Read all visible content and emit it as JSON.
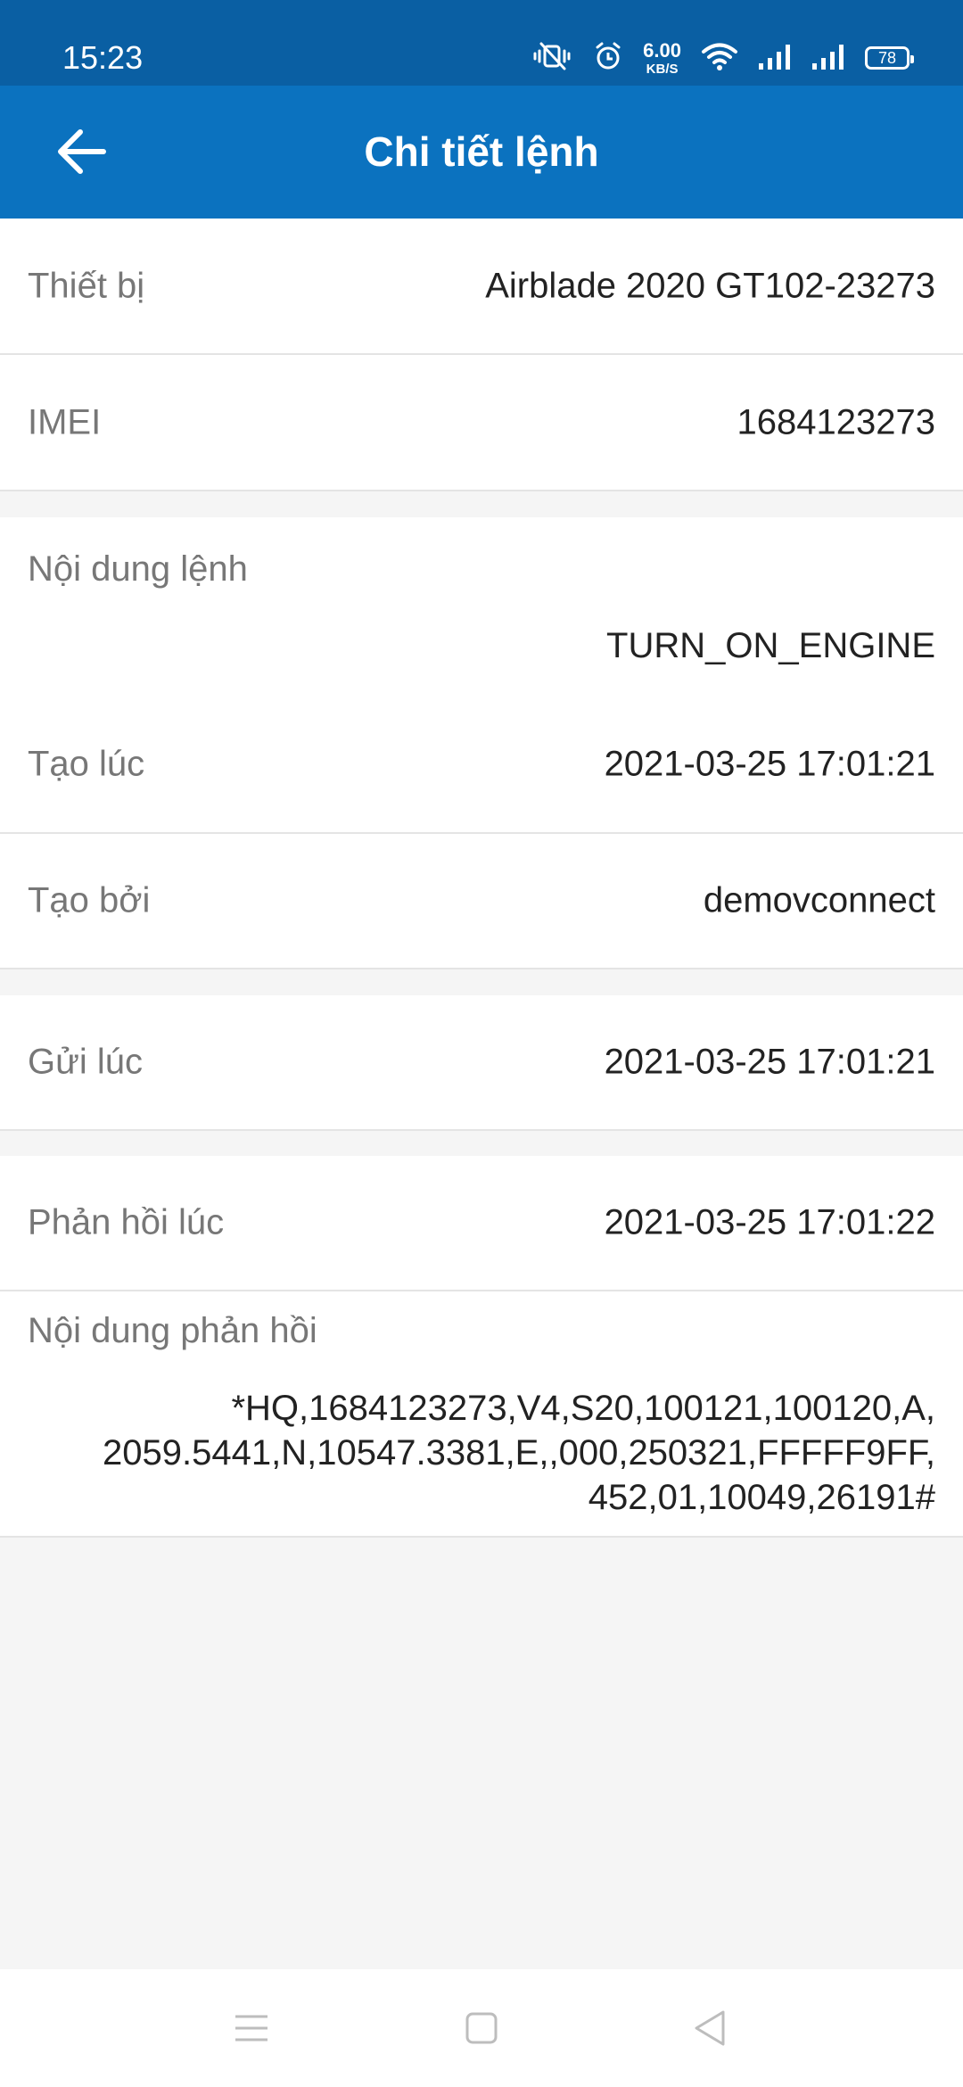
{
  "status_bar": {
    "time": "15:23",
    "net_speed_value": "6.00",
    "net_speed_unit": "KB/S",
    "battery_level": "78",
    "icons": [
      "vibrate-mute-icon",
      "alarm-icon",
      "wifi-icon",
      "signal-icon",
      "signal-icon",
      "battery-icon"
    ]
  },
  "app_bar": {
    "title": "Chi tiết lệnh",
    "back_icon": "arrow-left-icon"
  },
  "details": {
    "device_label": "Thiết bị",
    "device_value": "Airblade 2020 GT102-23273",
    "imei_label": "IMEI",
    "imei_value": "1684123273",
    "command_label": "Nội dung lệnh",
    "command_value": "TURN_ON_ENGINE",
    "created_at_label": "Tạo lúc",
    "created_at_value": "2021-03-25 17:01:21",
    "created_by_label": "Tạo bởi",
    "created_by_value": "demovconnect",
    "sent_at_label": "Gửi lúc",
    "sent_at_value": "2021-03-25 17:01:21",
    "responded_at_label": "Phản hồi lúc",
    "responded_at_value": "2021-03-25 17:01:22",
    "response_label": "Nội dung phản hồi",
    "response_line1": "*HQ,1684123273,V4,S20,100121,100120,A,",
    "response_line2": "2059.5441,N,10547.3381,E,,000,250321,FFFFF9FF,",
    "response_line3": "452,01,10049,26191#"
  },
  "nav_bar": {
    "icons": [
      "menu-icon",
      "home-square-icon",
      "back-triangle-icon"
    ]
  },
  "colors": {
    "status_bar": "#0a5fa3",
    "app_bar": "#0b72bf",
    "background": "#f5f5f5",
    "label": "#777777",
    "value": "#222222"
  }
}
